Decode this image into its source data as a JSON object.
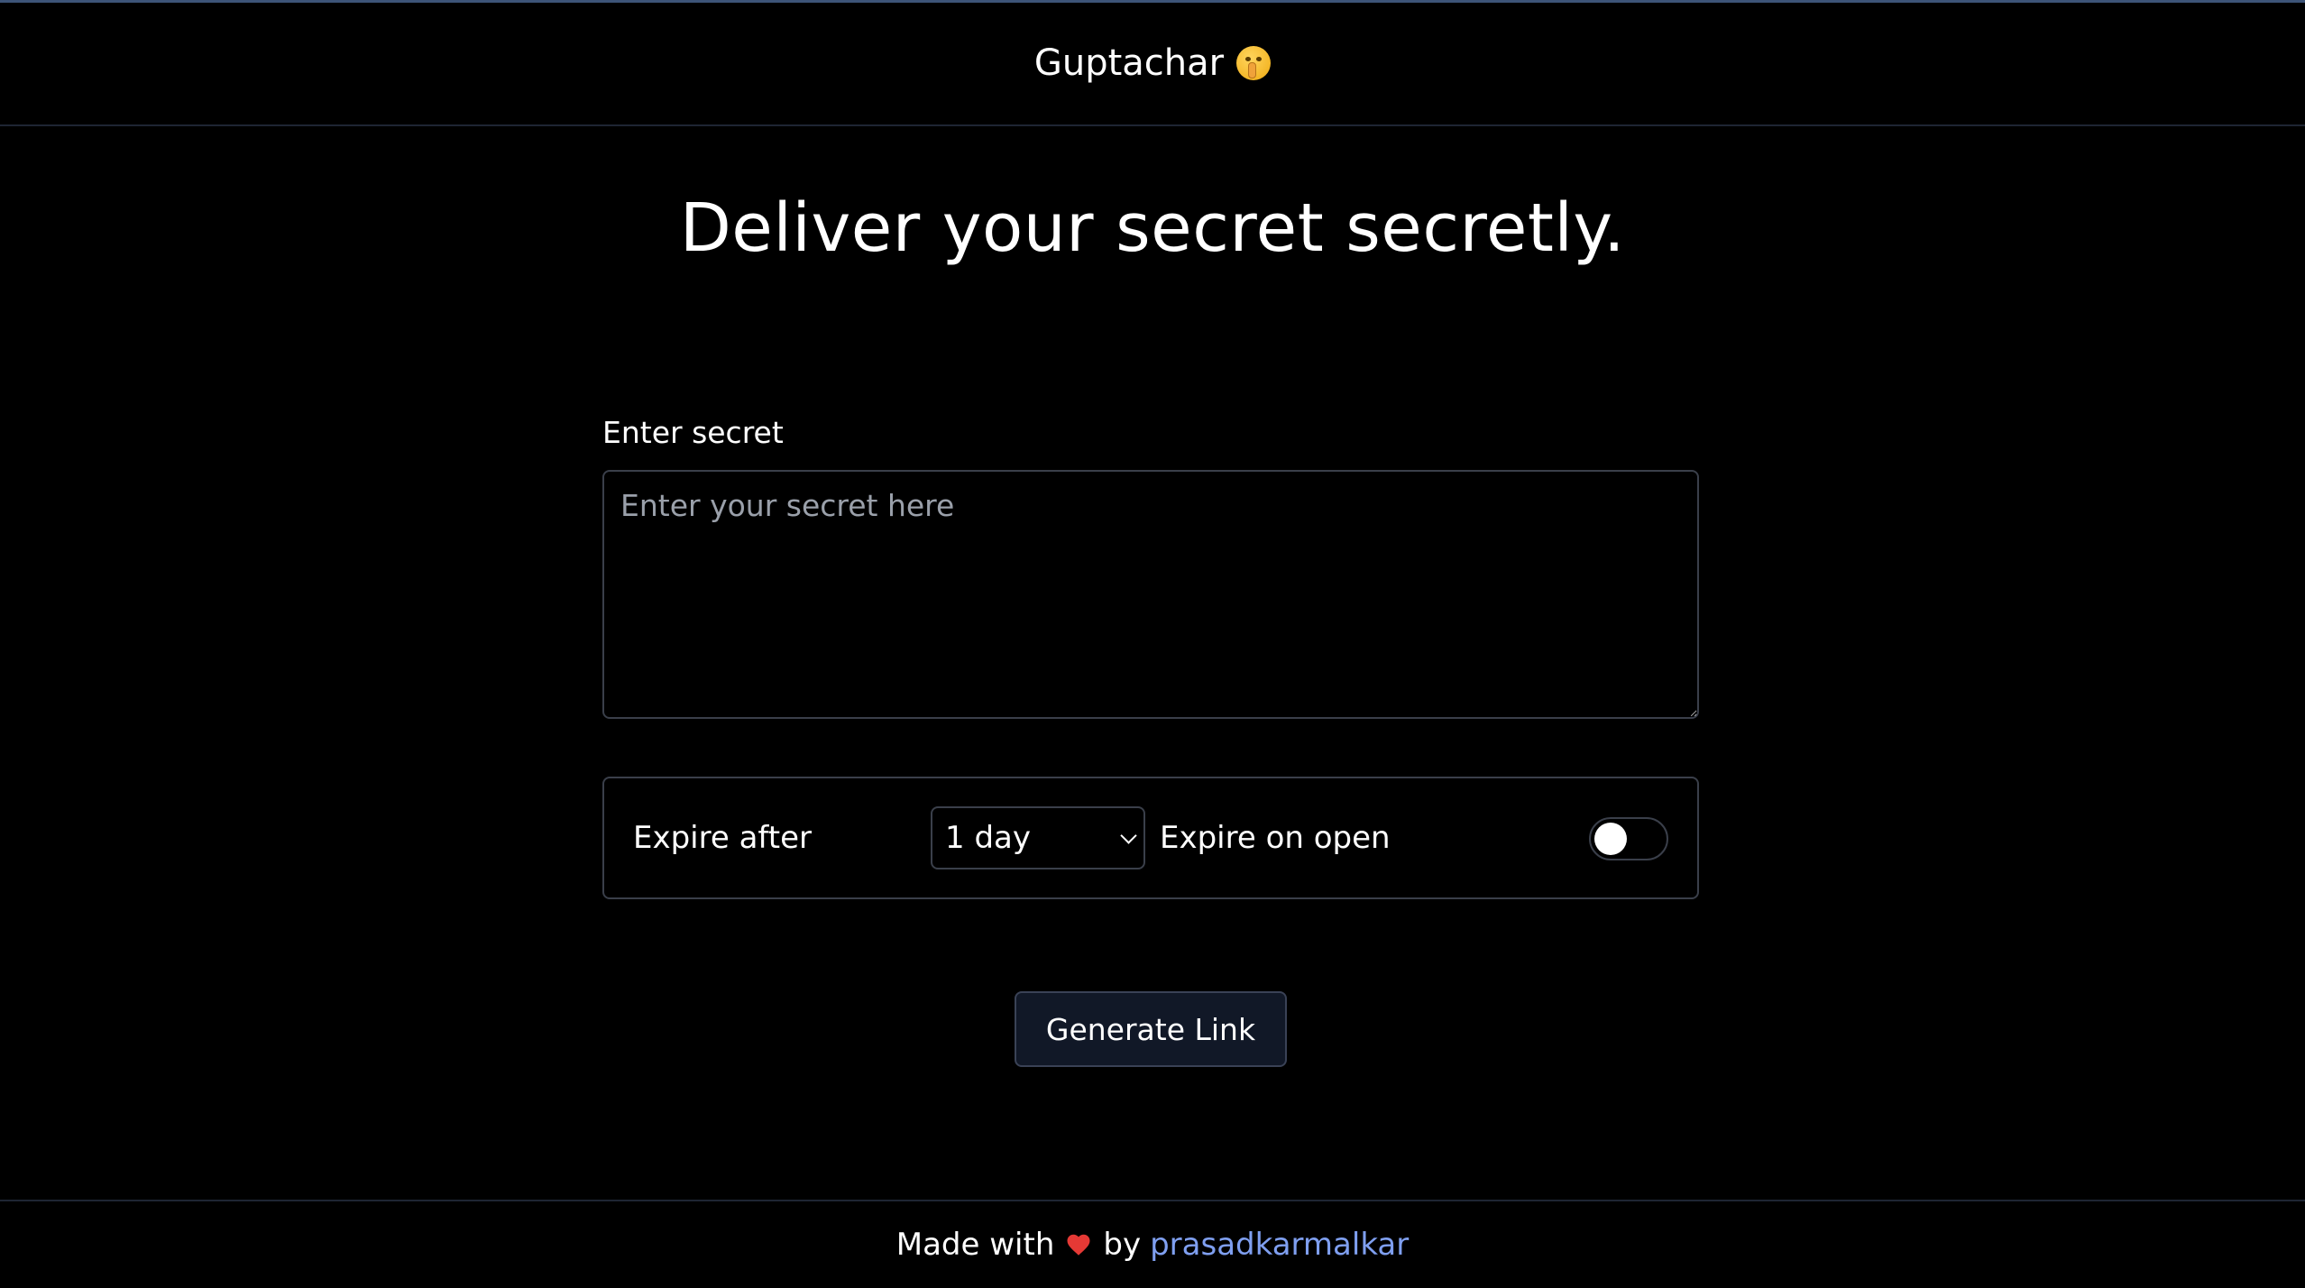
{
  "header": {
    "title": "Guptachar",
    "emoji_icon": "shushing-face-icon"
  },
  "hero": {
    "title": "Deliver your secret secretly."
  },
  "form": {
    "secret_label": "Enter secret",
    "secret_placeholder": "Enter your secret here",
    "secret_value": "",
    "expire_after_label": "Expire after",
    "expire_after_selected": "1 day",
    "expire_on_open_label": "Expire on open",
    "expire_on_open_enabled": false
  },
  "actions": {
    "generate_label": "Generate Link"
  },
  "footer": {
    "made_with": "Made with",
    "heart_icon": "heart-icon",
    "by": "by",
    "author": "prasadkarmalkar"
  },
  "colors": {
    "background": "#000000",
    "accent_link": "#7f9ff0",
    "border": "#3a3f4a",
    "button_bg": "#111827",
    "heart": "#e53935"
  }
}
